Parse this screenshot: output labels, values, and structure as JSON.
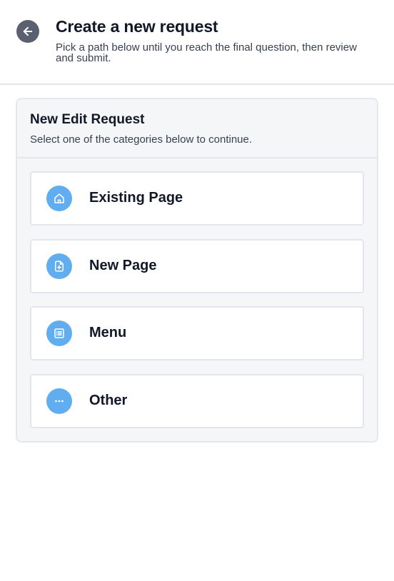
{
  "header": {
    "back_icon": "arrow-left-icon",
    "title": "Create a new request",
    "subtitle": "Pick a path below until you reach the final question, then review and submit."
  },
  "card": {
    "title": "New Edit Request",
    "subtitle": "Select one of the categories below to continue.",
    "options": [
      {
        "label": "Existing Page",
        "icon": "home-icon"
      },
      {
        "label": "New Page",
        "icon": "file-plus-icon"
      },
      {
        "label": "Menu",
        "icon": "list-icon"
      },
      {
        "label": "Other",
        "icon": "more-horizontal-icon"
      }
    ]
  },
  "colors": {
    "back_button": "#5b6070",
    "option_icon_bg": "#60adf0",
    "card_bg": "#f5f6f8",
    "border": "#e5e7eb"
  }
}
